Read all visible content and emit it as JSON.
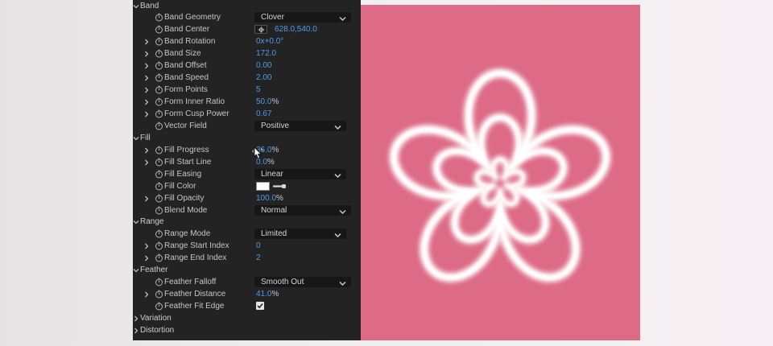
{
  "sections": {
    "band": "Band",
    "fill": "Fill",
    "range": "Range",
    "feather": "Feather",
    "variation": "Variation",
    "distortion": "Distortion"
  },
  "props": {
    "band_geometry": {
      "label": "Band Geometry",
      "value": "Clover"
    },
    "band_center": {
      "label": "Band Center",
      "value": "628.0,540.0"
    },
    "band_rotation": {
      "label": "Band Rotation",
      "value": "0x",
      "unit": "+0.0°"
    },
    "band_size": {
      "label": "Band Size",
      "value": "172.0"
    },
    "band_offset": {
      "label": "Band Offset",
      "value": "0.00"
    },
    "band_speed": {
      "label": "Band Speed",
      "value": "2.00"
    },
    "form_points": {
      "label": "Form Points",
      "value": "5"
    },
    "form_inner_ratio": {
      "label": "Form Inner Ratio",
      "value": "50.0",
      "unit": "%"
    },
    "form_cusp_power": {
      "label": "Form Cusp Power",
      "value": "0.67"
    },
    "vector_field": {
      "label": "Vector Field",
      "value": "Positive"
    },
    "fill_progress": {
      "label": "Fill Progress",
      "value": "36.0",
      "unit": "%"
    },
    "fill_start_line": {
      "label": "Fill Start Line",
      "value": "0.0",
      "unit": "%"
    },
    "fill_easing": {
      "label": "Fill Easing",
      "value": "Linear"
    },
    "fill_color": {
      "label": "Fill Color",
      "value": "#ffffff"
    },
    "fill_opacity": {
      "label": "Fill Opacity",
      "value": "100.0",
      "unit": "%"
    },
    "blend_mode": {
      "label": "Blend Mode",
      "value": "Normal"
    },
    "range_mode": {
      "label": "Range Mode",
      "value": "Limited"
    },
    "range_start_index": {
      "label": "Range Start Index",
      "value": "0"
    },
    "range_end_index": {
      "label": "Range End Index",
      "value": "2"
    },
    "feather_falloff": {
      "label": "Feather Falloff",
      "value": "Smooth Out"
    },
    "feather_distance": {
      "label": "Feather Distance",
      "value": "41.0",
      "unit": "%"
    },
    "feather_fit_edge": {
      "label": "Feather Fit Edge",
      "checked": true
    }
  },
  "colors": {
    "panel_bg": "#232323",
    "value_blue": "#4f9ae8",
    "preview_bg": "#dd6a86",
    "band_color": "#ffffff"
  },
  "icons": {
    "stopwatch": "stopwatch-icon",
    "chevron": "chevron-right-icon",
    "dropdown": "chevron-down-icon",
    "eyedropper": "eyedropper-icon",
    "target": "crosshair-icon"
  }
}
